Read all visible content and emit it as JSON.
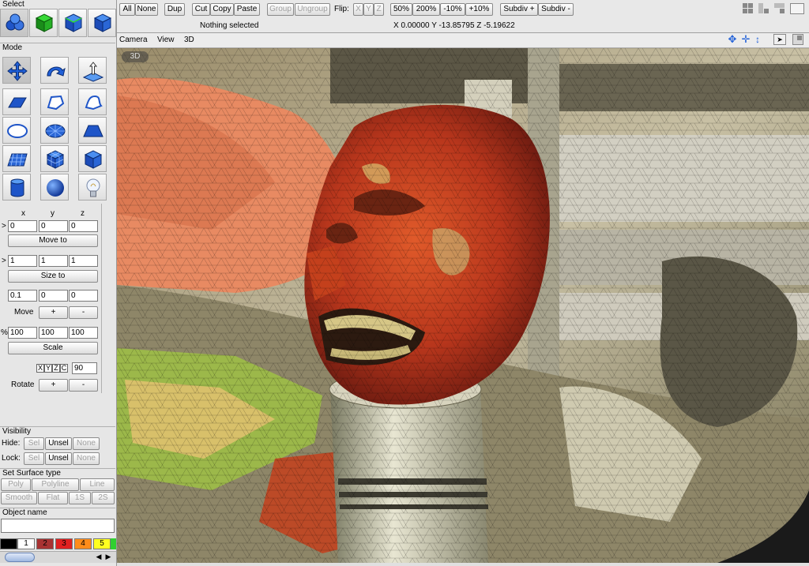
{
  "select_panel": {
    "title": "Select"
  },
  "toolbar": {
    "buttons": [
      "All",
      "None",
      "Dup",
      "Cut",
      "Copy",
      "Paste",
      "Group",
      "Ungroup"
    ],
    "flip_label": "Flip:",
    "flip_axes": [
      "X",
      "Y",
      "Z"
    ],
    "zoom_buttons": [
      "50%",
      "200%",
      "-10%",
      "+10%"
    ],
    "subdiv_buttons": [
      "Subdiv +",
      "Subdiv -"
    ],
    "status": "Nothing selected",
    "coordinates": "X 0.00000 Y -13.85795 Z -5.19622"
  },
  "menus": [
    "Camera",
    "View",
    "3D"
  ],
  "viewport": {
    "badge": "3D"
  },
  "mode_panel": {
    "title": "Mode"
  },
  "transform": {
    "axis_headers": [
      "x",
      "y",
      "z"
    ],
    "position": [
      "0",
      "0",
      "0"
    ],
    "move_to_label": "Move to",
    "size": [
      "1",
      "1",
      "1"
    ],
    "size_to_label": "Size to",
    "move_step": [
      "0.1",
      "0",
      "0"
    ],
    "move_label": "Move",
    "scale_percent": [
      "100",
      "100",
      "100"
    ],
    "scale_label": "Scale",
    "rotate_axes": [
      "X",
      "Y",
      "Z",
      "C"
    ],
    "rotate_angle": "90",
    "rotate_label": "Rotate",
    "plus": "+",
    "minus": "-",
    "arrow": ">",
    "percent": "%"
  },
  "visibility": {
    "title": "Visibility",
    "hide_label": "Hide:",
    "lock_label": "Lock:",
    "buttons": [
      "Sel",
      "Unsel",
      "None"
    ]
  },
  "surface": {
    "title": "Set Surface type",
    "row1": [
      "Poly",
      "Polyline",
      "Line"
    ],
    "row2": [
      "Smooth",
      "Flat",
      "1S",
      "2S"
    ]
  },
  "object_name": {
    "title": "Object name",
    "value": ""
  },
  "colors": {
    "swatches": [
      {
        "label": "",
        "color": "#000000"
      },
      {
        "label": "1",
        "color": "#ffffff"
      },
      {
        "label": "2",
        "color": "#a83232"
      },
      {
        "label": "3",
        "color": "#e02020"
      },
      {
        "label": "4",
        "color": "#ff8c1a"
      },
      {
        "label": "5",
        "color": "#ffff20"
      }
    ]
  }
}
